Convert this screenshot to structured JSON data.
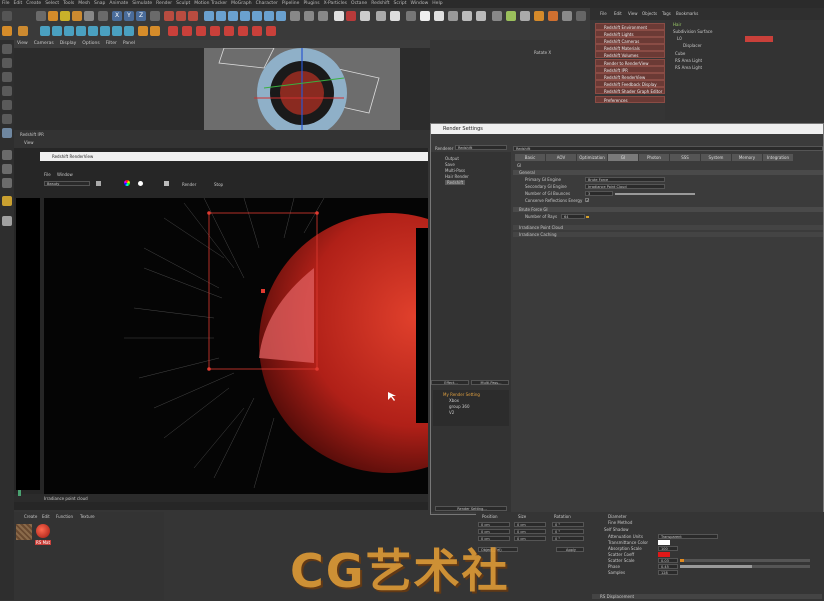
{
  "menubar": {
    "items": [
      "File",
      "Edit",
      "Create",
      "Select",
      "Tools",
      "Mesh",
      "Snap",
      "Animate",
      "Simulate",
      "Render",
      "Sculpt",
      "Motion Tracker",
      "MoGraph",
      "Character",
      "Pipeline",
      "Plugins",
      "X-Particles",
      "Octane",
      "Redshift",
      "Script",
      "Window",
      "Help"
    ]
  },
  "toolbar": {
    "axis_labels": [
      "X",
      "Y",
      "Z"
    ]
  },
  "object_manager": {
    "menu": [
      "File",
      "Edit",
      "View",
      "Objects",
      "Tags",
      "Bookmarks"
    ],
    "objects": [
      "Hair",
      "Subdivision Surface",
      "L0",
      "Displacer",
      "Cube",
      "RS Area Light",
      "RS Area Light"
    ]
  },
  "redshift_menu": {
    "items": [
      "Redshift Environment",
      "Redshift Lights",
      "Redshift Cameras",
      "Redshift Materials",
      "Redshift Volumes",
      "Render to RenderView",
      "Redshift IPR",
      "Redshift RenderView",
      "Redshift Feedback Display",
      "Redshift Shader Graph Editor",
      "Preferences"
    ]
  },
  "viewport": {
    "menu": [
      "View",
      "Cameras",
      "Display",
      "Options",
      "Filter",
      "Panel"
    ],
    "name": "Perspective",
    "info": "Rotate X"
  },
  "ipr_panel": {
    "title": "Redshift IPR",
    "view_label": "View"
  },
  "renderview": {
    "title": "Redshift RenderView",
    "menu": [
      "File",
      "Window"
    ],
    "aov_select": "Beauty",
    "render_label": "Render",
    "stop_label": "Stop",
    "status": "Irradiance point cloud"
  },
  "render_settings": {
    "title": "Render Settings",
    "renderer_label": "Renderer",
    "renderer_value": "Redshift",
    "tree": [
      "Output",
      "Save",
      "Multi-Pass",
      "Hair Render",
      "Redshift"
    ],
    "effect_button": "Effect...",
    "multipass_button": "Multi-Pass...",
    "presets": [
      "My Render Setting",
      "Xbox",
      "group 360",
      "V2"
    ],
    "footer": "Render Setting...",
    "header_field": "Redshift",
    "tabs": [
      "Basic",
      "AOV",
      "Optimization",
      "GI",
      "Photon",
      "SSS",
      "System",
      "Memory",
      "Integration"
    ],
    "active_tab": "GI",
    "sections": {
      "general": "General",
      "brute_force": "Brute Force GI",
      "irradiance_point_cloud": "Irradiance Point Cloud",
      "irradiance_caching": "Irradiance Caching"
    },
    "fields": {
      "primary_engine_label": "Primary GI Engine",
      "primary_engine_value": "Brute Force",
      "secondary_engine_label": "Secondary GI Engine",
      "secondary_engine_value": "Irradiance Point Cloud",
      "bounces_label": "Number of GI Bounces",
      "bounces_value": "3",
      "conserve_label": "Conserve Reflections Energy",
      "rays_label": "Number of Rays",
      "rays_value": "64"
    }
  },
  "material_manager": {
    "menu": [
      "Create",
      "Edit",
      "Function",
      "Texture"
    ],
    "mat_label": "RS Mat"
  },
  "coordinates": {
    "headers": [
      "Position",
      "Size",
      "Rotation"
    ],
    "rows": [
      {
        "pos": "0 cm",
        "size": "0 cm",
        "rot": "0 °"
      },
      {
        "pos": "0 cm",
        "size": "0 cm",
        "rot": "0 °"
      },
      {
        "pos": "0 cm",
        "size": "0 cm",
        "rot": "0 °"
      }
    ],
    "mode": "Object (Rel)",
    "apply": "Apply"
  },
  "attributes": {
    "rows": [
      "Diameter",
      "Fine Method",
      "Self Shadow",
      "Attenuation Units",
      "Transmittance Color",
      "Absorption Scale",
      "Scatter Coeff",
      "Scatter Scale",
      "Phase",
      "Samples"
    ],
    "values": [
      "",
      "",
      "",
      "Transparent",
      "",
      "100",
      "",
      "0.03",
      "0.45",
      "128"
    ],
    "footer": "RS Displacement"
  },
  "watermark": "CG艺术社",
  "colors": {
    "accent_red": "#c0302a",
    "ui_bg": "#353535",
    "highlight_orange": "#e08a20"
  }
}
